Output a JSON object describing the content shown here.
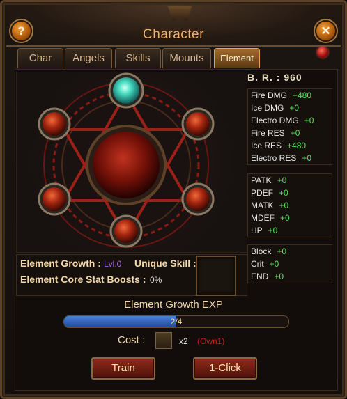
{
  "window": {
    "title": "Character"
  },
  "buttons": {
    "help": "?",
    "close": "✕"
  },
  "tabs": [
    {
      "label": "Char"
    },
    {
      "label": "Angels"
    },
    {
      "label": "Skills"
    },
    {
      "label": "Mounts"
    },
    {
      "label": "Element",
      "active": true
    }
  ],
  "br": "B. R. :  960",
  "stats": {
    "group1": [
      {
        "label": "Fire DMG",
        "value": "+480"
      },
      {
        "label": "Ice DMG",
        "value": "+0"
      },
      {
        "label": "Electro DMG",
        "value": "+0"
      },
      {
        "label": "Fire RES",
        "value": "+0"
      },
      {
        "label": "Ice RES",
        "value": "+480"
      },
      {
        "label": "Electro RES",
        "value": "+0"
      }
    ],
    "group2": [
      {
        "label": "PATK",
        "value": "+0"
      },
      {
        "label": "PDEF",
        "value": "+0"
      },
      {
        "label": "MATK",
        "value": "+0"
      },
      {
        "label": "MDEF",
        "value": "+0"
      },
      {
        "label": "HP",
        "value": "+0"
      }
    ],
    "group3": [
      {
        "label": "Block",
        "value": "+0"
      },
      {
        "label": "Crit",
        "value": "+0"
      },
      {
        "label": "END",
        "value": "+0"
      }
    ]
  },
  "growth": {
    "label": "Element Growth :",
    "level": "Lvl.0",
    "unique_skill_label": "Unique Skill :",
    "core_boost_label": "Element Core Stat Boosts :",
    "core_boost_value": "0%"
  },
  "exp": {
    "title": "Element Growth EXP",
    "text": "2/4",
    "fraction": 0.5
  },
  "cost": {
    "label": "Cost :",
    "qty": "x2",
    "own": "(Own1)"
  },
  "actions": {
    "train": "Train",
    "one_click": "1-Click"
  },
  "colors": {
    "accent": "#f1b46a",
    "stat_value": "#59e05a",
    "level": "#b06bf0",
    "own": "#c82020"
  },
  "icons": {
    "gem": "ruby-gem-icon",
    "item": "scroll-item-icon"
  }
}
